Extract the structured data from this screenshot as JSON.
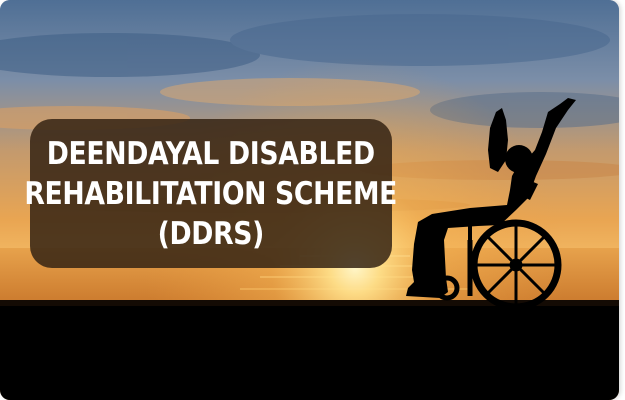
{
  "banner": {
    "title_lines": [
      "DEENDAYAL DISABLED",
      "REHABILITATION SCHEME",
      "(DDRS)"
    ]
  },
  "scene": {
    "subject": "silhouette-person-in-wheelchair-arms-raised",
    "sky_top_color": "#4f6f95",
    "sun_color": "#fff6c8",
    "ground_color": "#000000"
  }
}
